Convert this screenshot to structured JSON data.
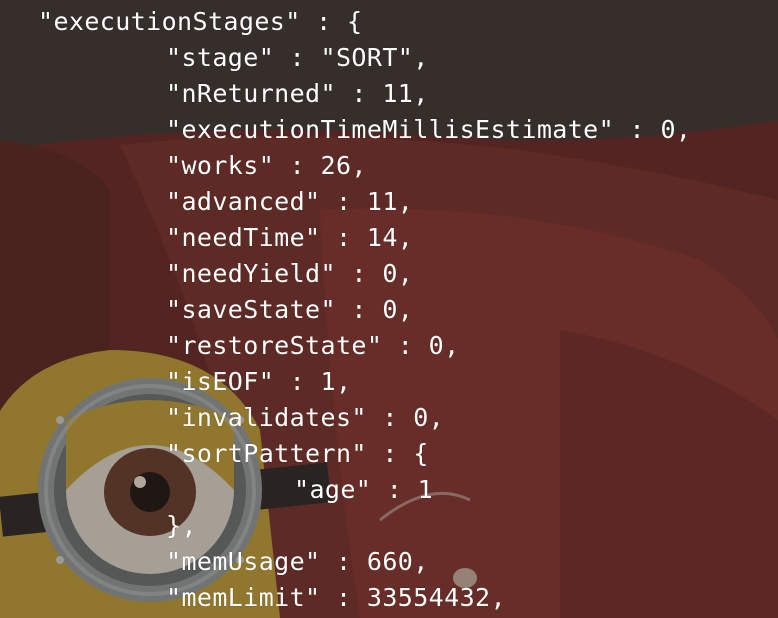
{
  "terminal": {
    "lines": [
      "\"executionStages\" : {",
      "\"stage\" : \"SORT\",",
      "\"nReturned\" : 11,",
      "\"executionTimeMillisEstimate\" : 0,",
      "\"works\" : 26,",
      "\"advanced\" : 11,",
      "\"needTime\" : 14,",
      "\"needYield\" : 0,",
      "\"saveState\" : 0,",
      "\"restoreState\" : 0,",
      "\"isEOF\" : 1,",
      "\"invalidates\" : 0,",
      "\"sortPattern\" : {",
      "\"age\" : 1",
      "},",
      "\"memUsage\" : 660,",
      "\"memLimit\" : 33554432,"
    ]
  },
  "colors": {
    "text": "#ffffff",
    "background": "#3a302c",
    "wallpaper_red": "#7a2a28"
  },
  "icons": {
    "wallpaper": "minion-wallpaper-icon"
  }
}
